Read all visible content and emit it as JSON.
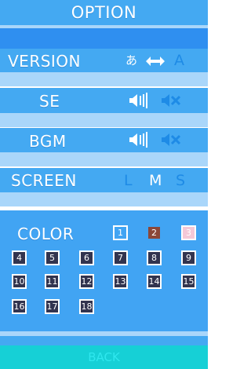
{
  "title": "OPTION",
  "rows": {
    "version": {
      "label": "VERSION",
      "left_glyph": "あ",
      "arrow_icon": "double-arrow-icon",
      "right_glyph": "A"
    },
    "se": {
      "label": "SE",
      "on_icon": "speaker-on-icon",
      "off_icon": "speaker-mute-icon"
    },
    "bgm": {
      "label": "BGM",
      "on_icon": "speaker-on-icon",
      "off_icon": "speaker-mute-icon"
    },
    "screen": {
      "label": "SCREEN",
      "options": [
        "L",
        "M",
        "S"
      ],
      "selected": "M"
    }
  },
  "color": {
    "label": "COLOR",
    "swatches": [
      "1",
      "2",
      "3",
      "4",
      "5",
      "6",
      "7",
      "8",
      "9",
      "10",
      "11",
      "12",
      "13",
      "14",
      "15",
      "16",
      "17",
      "18"
    ],
    "selected": "2"
  },
  "back_label": "BACK",
  "colors": {
    "sky": "#44a9f2",
    "deep": "#2f8ff0",
    "pale": "#a9d6fa",
    "teal": "#16d0d6",
    "swatch_dark": "#32344f",
    "swatch_brown": "#8b4738",
    "swatch_pink": "#f4c8d7"
  }
}
